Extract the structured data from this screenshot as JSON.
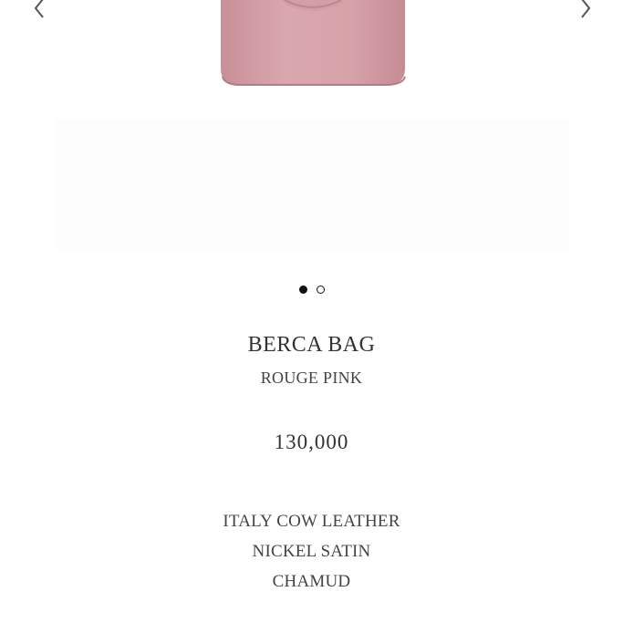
{
  "carousel": {
    "prev_icon": "chevron-left-icon",
    "next_icon": "chevron-right-icon",
    "image_color": "#d5a4ab",
    "slide_count": 2,
    "active_slide": 1
  },
  "product": {
    "name": "BERCA BAG",
    "color": "ROUGE PINK",
    "price": "130,000",
    "details": [
      "ITALY COW LEATHER",
      "NICKEL SATIN",
      "CHAMUD"
    ]
  }
}
